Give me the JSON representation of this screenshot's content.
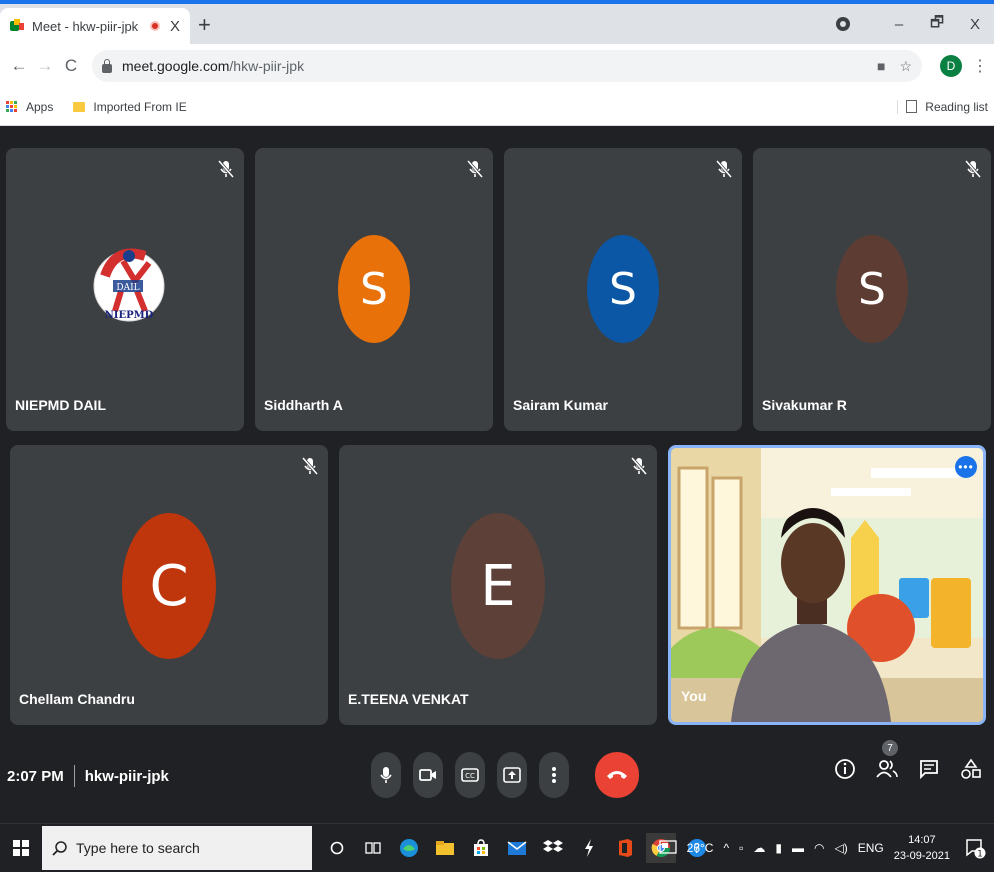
{
  "browser": {
    "tab_title": "Meet - hkw-piir-jpk",
    "tab_close": "X",
    "new_tab": "+",
    "url_host": "meet.google.com",
    "url_path": "/hkw-piir-jpk",
    "profile_initial": "D",
    "window_controls": [
      "–",
      "🗗",
      "X"
    ]
  },
  "bookmarks": {
    "apps_label": "Apps",
    "imported_label": "Imported From IE",
    "reading_list_label": "Reading list"
  },
  "participants": [
    {
      "name": "NIEPMD DAIL",
      "initial": "",
      "color": "",
      "logo_text": "NIEPMD",
      "logo_inner": "DAIL"
    },
    {
      "name": "Siddharth A",
      "initial": "S",
      "color": "#e8710a"
    },
    {
      "name": "Sairam Kumar",
      "initial": "S",
      "color": "#0b57a6"
    },
    {
      "name": "Sivakumar R",
      "initial": "S",
      "color": "#5d3d33"
    },
    {
      "name": "Chellam Chandru",
      "initial": "C",
      "color": "#bf360c"
    },
    {
      "name": "E.TEENA VENKAT",
      "initial": "E",
      "color": "#5d4037"
    },
    {
      "name": "You"
    }
  ],
  "meeting": {
    "time": "2:07 PM",
    "code": "hkw-piir-jpk",
    "participant_count": "7",
    "more_options_glyph": "•••"
  },
  "taskbar": {
    "search_placeholder": "Type here to search",
    "weather": "26°C",
    "language": "ENG",
    "time": "14:07",
    "date": "23-09-2021",
    "notification_count": "1"
  }
}
